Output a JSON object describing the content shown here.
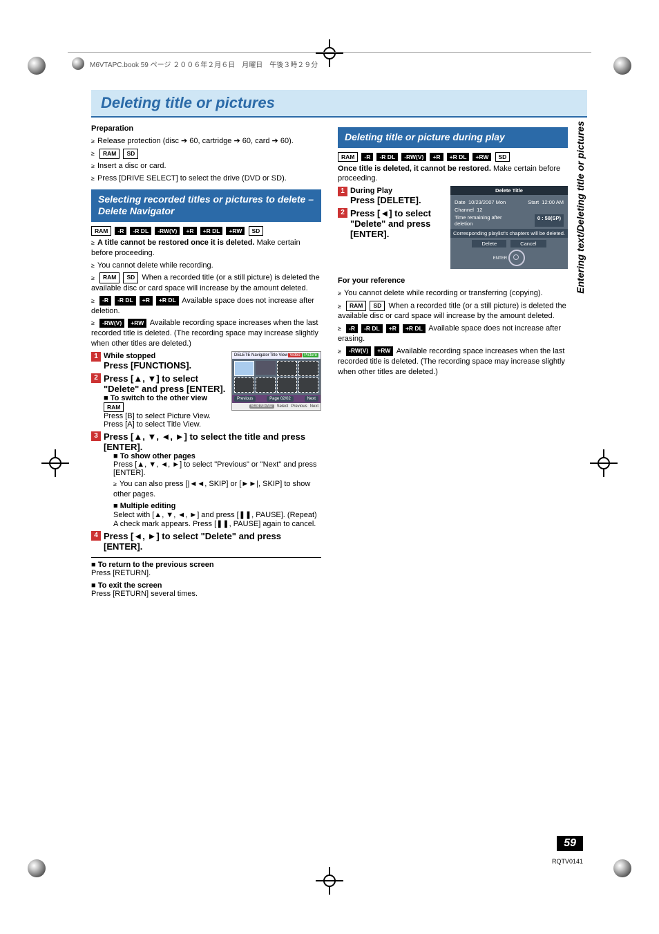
{
  "topbar": "M6VTAPC.book  59 ページ  ２００６年２月６日　月曜日　午後３時２９分",
  "side_label": "Entering text/Deleting title or pictures",
  "page_title": "Deleting title or pictures",
  "prep": {
    "heading": "Preparation",
    "items": [
      "Release protection (disc ➔ 60, cartridge ➔ 60, card ➔ 60).",
      "",
      "Insert a disc or card.",
      "Press [DRIVE SELECT] to select the drive (DVD or SD)."
    ],
    "badges_line1": [
      "RAM",
      "SD"
    ]
  },
  "sectionA": {
    "heading": "Selecting recorded titles or pictures to delete – Delete Navigator",
    "badges": [
      "RAM",
      "-R",
      "-R DL",
      "-RW(V)",
      "+R",
      "+R DL",
      "+RW",
      "SD"
    ],
    "warn": "A title cannot be restored once it is deleted.",
    "warn_tail": " Make certain before proceeding.",
    "bullets": [
      "You cannot delete while recording."
    ],
    "b2_pre_badges": [
      "RAM",
      "SD"
    ],
    "b2": " When a recorded title (or a still picture) is deleted the available disc or card space will increase by the amount deleted.",
    "b3_pre_badges": [
      "-R",
      "-R DL",
      "+R",
      "+R DL"
    ],
    "b3": " Available space does not increase after deletion.",
    "b4_pre_badges": [
      "-RW(V)",
      "+RW"
    ],
    "b4": " Available recording space increases when the last recorded title is deleted. (The recording space may increase slightly when other titles are deleted.)",
    "step1_pre": "While stopped",
    "step1": "Press [FUNCTIONS].",
    "step2": "Press [▲, ▼] to select \"Delete\" and press [ENTER].",
    "step2_sub_heading": "■ To switch to the other view ",
    "step2_sub_badge": "RAM",
    "step2_sub_a": "Press [B] to select Picture View.",
    "step2_sub_b": "Press [A] to select Title View.",
    "step3": "Press [▲, ▼, ◄, ►] to select the title and press [ENTER].",
    "step3_s1h": "■ To show other pages",
    "step3_s1": "Press [▲, ▼, ◄, ►] to select \"Previous\" or \"Next\" and press [ENTER].",
    "step3_s1b": "You can also press [|◄◄, SKIP] or [►►|, SKIP] to show other pages.",
    "step3_s2h": "■ Multiple editing",
    "step3_s2": "Select with [▲, ▼, ◄, ►] and press [❚❚, PAUSE]. (Repeat)",
    "step3_s2b": "A check mark appears. Press [❚❚, PAUSE] again to cancel.",
    "step4": "Press [◄, ►] to select \"Delete\" and press [ENTER].",
    "ret_h": "■ To return to the previous screen",
    "ret": "Press [RETURN].",
    "exit_h": "■ To exit the screen",
    "exit": "Press [RETURN] several times.",
    "nav": {
      "title_l": "DELETE Navigator",
      "title_r": "Title View",
      "chips": [
        "Video",
        "Picture"
      ],
      "pager": [
        "Previous",
        "Page 02/02",
        "Next"
      ],
      "bottom": [
        "SUB MENU",
        "Select",
        "Previous",
        "Next"
      ]
    }
  },
  "sectionB": {
    "heading": "Deleting title or picture during play",
    "badges": [
      "RAM",
      "-R",
      "-R DL",
      "-RW(V)",
      "+R",
      "+R DL",
      "+RW",
      "SD"
    ],
    "warn": "Once title is deleted, it cannot be restored.",
    "warn_tail": " Make certain before proceeding.",
    "step1_pre": "During Play",
    "step1": "Press [DELETE].",
    "step2": "Press [◄] to select \"Delete\" and press [ENTER].",
    "ref_h": "For your reference",
    "r1": "You cannot delete while recording or transferring (copying).",
    "r2_badges": [
      "RAM",
      "SD"
    ],
    "r2": " When a recorded title (or a still picture) is deleted the available disc or card space will increase by the amount deleted.",
    "r3_badges": [
      "-R",
      "-R DL",
      "+R",
      "+R DL"
    ],
    "r3": " Available space does not increase after erasing.",
    "r4_badges": [
      "-RW(V)",
      "+RW"
    ],
    "r4": " Available recording space increases when the last recorded title is deleted. (The recording space may increase slightly when other titles are deleted.)",
    "panel": {
      "title": "Delete Title",
      "date_l": "Date",
      "date_v": "10/23/2007 Mon",
      "start_l": "Start",
      "start_v": "12:00 AM",
      "ch_l": "Channel",
      "ch_v": "12",
      "tr_l": "Time remaining after deletion",
      "tr_v": "0 : 58(SP)",
      "warn": "Corresponding playlist's chapters will be deleted.",
      "btn_del": "Delete",
      "btn_cancel": "Cancel",
      "enter": "ENTER"
    }
  },
  "pagenum": "59",
  "docid": "RQTV0141"
}
